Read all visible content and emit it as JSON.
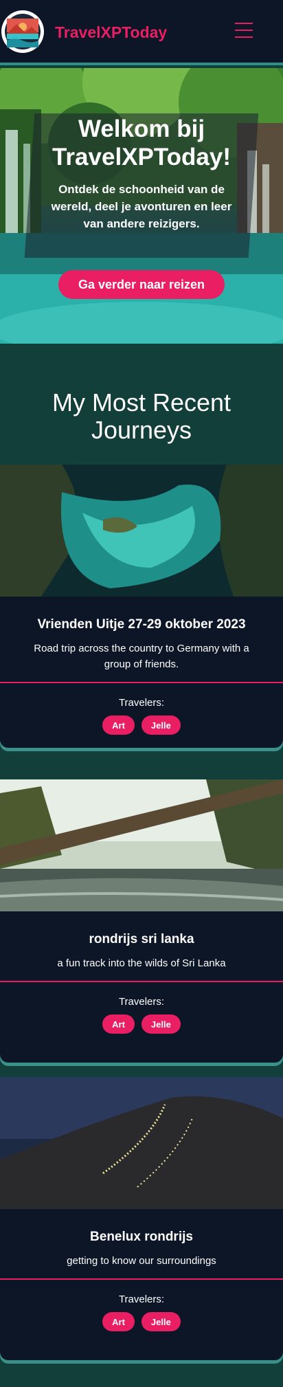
{
  "header": {
    "brand": "TravelXPToday",
    "logo_icon": "landscape-logo-icon",
    "menu_icon": "hamburger-menu-icon"
  },
  "hero": {
    "title": "Welkom bij TravelXPToday!",
    "subtitle": "Ontdek de schoonheid van de wereld, deel je avonturen en leer van andere reizigers.",
    "cta_label": "Ga verder naar reizen"
  },
  "section": {
    "title": "My Most Recent Journeys"
  },
  "journeys": [
    {
      "title": "Vrienden Uitje 27-29 oktober 2023",
      "description": "Road trip across the country to Germany with a group of friends.",
      "travelers_label": "Travelers:",
      "travelers": [
        "Art",
        "Jelle"
      ]
    },
    {
      "title": "rondrijs sri lanka",
      "description": "a fun track into the wilds of Sri Lanka",
      "travelers_label": "Travelers:",
      "travelers": [
        "Art",
        "Jelle"
      ]
    },
    {
      "title": "Benelux rondrijs",
      "description": "getting to know our surroundings",
      "travelers_label": "Travelers:",
      "travelers": [
        "Art",
        "Jelle"
      ]
    }
  ],
  "colors": {
    "accent": "#e91e63",
    "header_bg": "#0d1627",
    "page_bg": "#123f3a",
    "border": "#2b8f86"
  }
}
